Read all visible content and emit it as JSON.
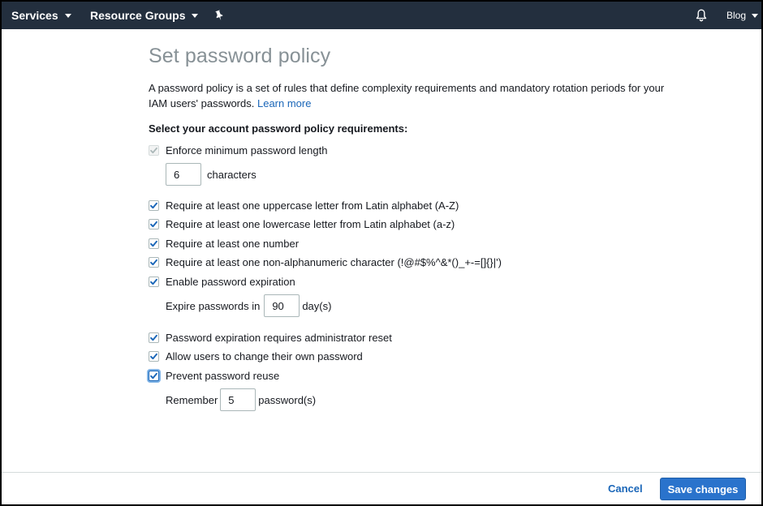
{
  "nav": {
    "services": "Services",
    "resource_groups": "Resource Groups",
    "pin_icon": "pin-icon",
    "bell_icon": "bell-icon",
    "account": "Blog"
  },
  "page": {
    "title": "Set password policy",
    "description": "A password policy is a set of rules that define complexity requirements and mandatory rotation periods for your IAM users' passwords.",
    "learn_more": "Learn more",
    "section_title": "Select your account password policy requirements:"
  },
  "policy": {
    "min_length": {
      "label": "Enforce minimum password length",
      "checked": true,
      "disabled": true
    },
    "min_length_value": "6",
    "min_length_unit": "characters",
    "uppercase": {
      "label": "Require at least one uppercase letter from Latin alphabet (A-Z)",
      "checked": true
    },
    "lowercase": {
      "label": "Require at least one lowercase letter from Latin alphabet (a-z)",
      "checked": true
    },
    "number": {
      "label": "Require at least one number",
      "checked": true
    },
    "nonalnum": {
      "label": "Require at least one non-alphanumeric character (!@#$%^&*()_+-=[]{}|')",
      "checked": true
    },
    "expiration": {
      "label": "Enable password expiration",
      "checked": true
    },
    "expire_prefix": "Expire passwords in",
    "expire_value": "90",
    "expire_unit": "day(s)",
    "admin_reset": {
      "label": "Password expiration requires administrator reset",
      "checked": true
    },
    "allow_change": {
      "label": "Allow users to change their own password",
      "checked": true
    },
    "prevent_reuse": {
      "label": "Prevent password reuse",
      "checked": true
    },
    "remember_prefix": "Remember",
    "remember_value": "5",
    "remember_unit": "password(s)"
  },
  "footer": {
    "cancel": "Cancel",
    "save": "Save changes"
  },
  "colors": {
    "nav_bg": "#232f3e",
    "title": "#879196",
    "link": "#1a66b8",
    "primary_button": "#2a73cc",
    "checkbox_check": "#1a66b8"
  }
}
